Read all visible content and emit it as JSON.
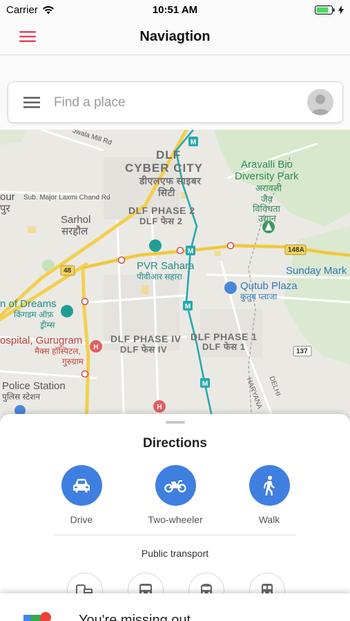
{
  "status_bar": {
    "carrier": "Carrier",
    "time": "10:51 AM"
  },
  "nav": {
    "title": "Naviagtion",
    "menu_icon": "hamburger-icon",
    "accent": "#e8475f"
  },
  "search": {
    "placeholder": "Find a place",
    "value": ""
  },
  "map": {
    "labels": {
      "jwala_mill": "Jwala Mill Rd",
      "dlf": "DLF",
      "cyber_city": "CYBER CITY",
      "cyber_city_hi": "डीएलएफ साइबर",
      "cyber_city_hi2": "सिटी",
      "aravalli1": "Aravalli Bio",
      "aravalli2": "Diversity Park",
      "aravalli_hi1": "अरावली",
      "aravalli_hi2": "जैव",
      "aravalli_hi3": "विविधता",
      "aravalli_hi4": "उद्यान",
      "our": "our",
      "pur": "पुर",
      "laxmi_chand": "Sub. Major Laxmi Chand Rd",
      "sarhol": "Sarhol",
      "sarhol_hi": "सरहौल",
      "phase2": "DLF PHASE 2",
      "phase2_hi": "DLF फेस 2",
      "pvr": "PVR Sahara",
      "pvr_hi": "पीवीआर सहारा",
      "road_48": "48",
      "road_148a": "148A",
      "sunday": "Sunday Mark",
      "qutub": "Qutub Plaza",
      "qutub_hi": "कुतुब प्लाजा",
      "dreams": "n of Dreams",
      "dreams_hi1": "किंगडम ऑफ़",
      "dreams_hi2": "ड्रीम्स",
      "hospital": "ospital, Gurugram",
      "hospital_hi1": "मैक्स हॉस्पिटल,",
      "hospital_hi2": "गुरुग्राम",
      "phase4": "DLF PHASE IV",
      "phase4_hi": "DLF फेस IV",
      "phase1": "DLF PHASE 1",
      "phase1_hi": "DLF फेस 1",
      "road_137": "137",
      "police": "Police Station",
      "police_hi": "पुलिस स्टेशन",
      "haryana": "HARYANA",
      "delhi": "DELHI"
    }
  },
  "directions": {
    "title": "Directions",
    "modes": [
      {
        "label": "Drive",
        "icon": "car-icon"
      },
      {
        "label": "Two-wheeler",
        "icon": "motorcycle-icon"
      },
      {
        "label": "Walk",
        "icon": "walk-icon"
      }
    ],
    "public_transport_label": "Public transport",
    "transit_icons": [
      "train-bus-icon",
      "bus-icon",
      "metro-icon",
      "rail-icon"
    ],
    "accent": "#3f7fe0"
  },
  "banner": {
    "text": "You're missing out"
  }
}
